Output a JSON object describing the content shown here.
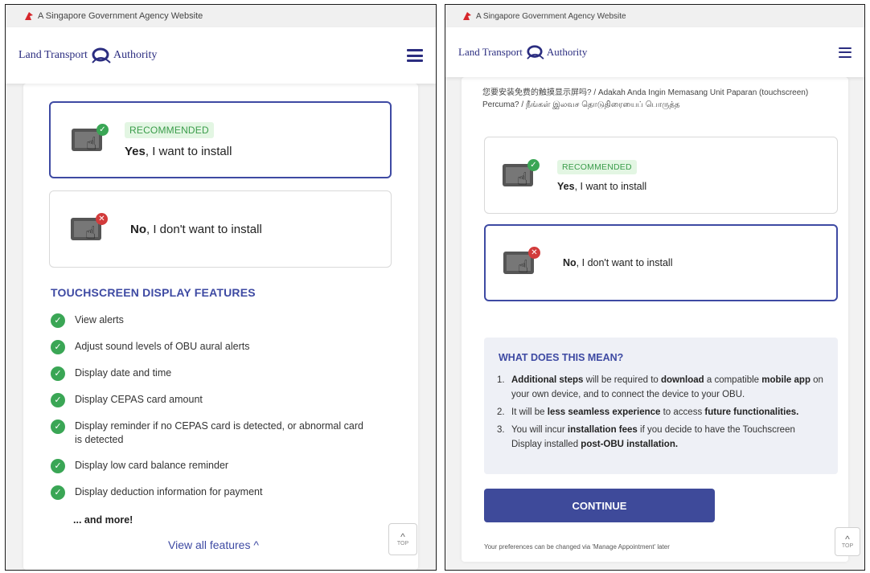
{
  "gov_banner": {
    "text": "A Singapore Government Agency Website"
  },
  "header": {
    "logo_left": "Land Transport",
    "logo_right": "Authority"
  },
  "left_panel": {
    "options": [
      {
        "tag": "RECOMMENDED",
        "bold": "Yes",
        "rest": ", I want to install",
        "selected": true
      },
      {
        "bold": "No",
        "rest": ", I don't want to install",
        "selected": false
      }
    ],
    "features_title": "TOUCHSCREEN DISPLAY FEATURES",
    "features": [
      "View alerts",
      "Adjust sound levels of OBU aural alerts",
      "Display date and time",
      "Display CEPAS card amount",
      "Display reminder if no CEPAS card is detected, or abnormal card is detected",
      "Display low card balance reminder",
      "Display deduction information for payment"
    ],
    "and_more": "... and more!",
    "view_all": "View all features ^",
    "top_label": "TOP"
  },
  "right_panel": {
    "question": "您要安装免费的触摸显示屏吗? / Adakah Anda Ingin Memasang Unit Paparan (touchscreen) Percuma? / நீங்கள் இலவச தொடுதிரையைப் பொருத்த",
    "options": [
      {
        "tag": "RECOMMENDED",
        "bold": "Yes",
        "rest": ", I want to install",
        "selected": false
      },
      {
        "bold": "No",
        "rest": ", I don't want to install",
        "selected": true
      }
    ],
    "info_title": "WHAT DOES THIS MEAN?",
    "info_items": [
      {
        "num": "1.",
        "html_parts": [
          {
            "b": "Additional steps"
          },
          {
            "t": " will be required to "
          },
          {
            "b": "download"
          },
          {
            "t": " a compatible "
          },
          {
            "b": "mobile app"
          },
          {
            "t": " on your own device, and to connect the device to your OBU."
          }
        ]
      },
      {
        "num": "2.",
        "html_parts": [
          {
            "t": "It will be "
          },
          {
            "b": "less seamless experience"
          },
          {
            "t": " to access "
          },
          {
            "b": "future functionalities."
          }
        ]
      },
      {
        "num": "3.",
        "html_parts": [
          {
            "t": "You will incur "
          },
          {
            "b": "installation fees"
          },
          {
            "t": " if you decide to have the Touchscreen Display installed "
          },
          {
            "b": "post-OBU installation."
          }
        ]
      }
    ],
    "continue_label": "CONTINUE",
    "footnote": "Your preferences can be changed via 'Manage Appointment' later",
    "top_label": "TOP"
  },
  "colors": {
    "brand": "#3e4aa3",
    "success": "#3aa655",
    "danger": "#d23b3b",
    "button": "#3e4a9a"
  },
  "icons": [
    "lion-icon",
    "lta-logo-icon",
    "hamburger-icon",
    "touchscreen-icon",
    "check-icon",
    "cross-icon",
    "chevron-up-icon"
  ]
}
